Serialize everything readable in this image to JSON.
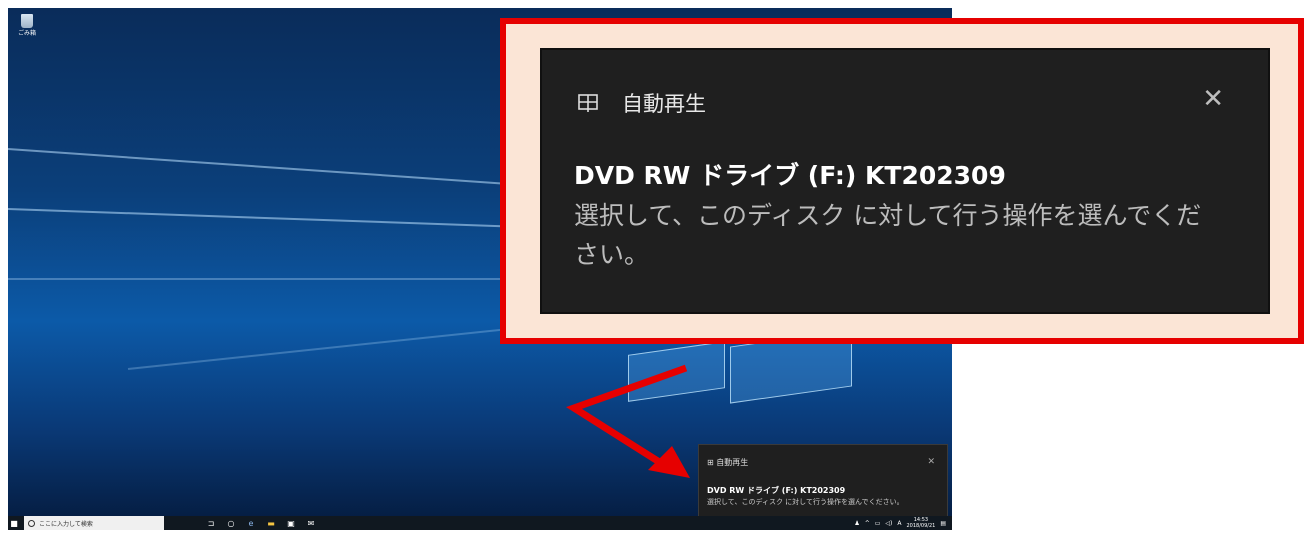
{
  "desktop": {
    "recycle_bin_label": "ごみ箱"
  },
  "taskbar": {
    "search_placeholder": "ここに入力して検索",
    "clock_time": "14:53",
    "clock_date": "2018/09/21",
    "ime_indicator": "A",
    "icons": [
      "windows-icon",
      "cortana-icon",
      "task-view-icon",
      "edge-icon",
      "file-explorer-icon",
      "store-icon",
      "mail-icon"
    ]
  },
  "toast": {
    "header": "自動再生",
    "device": "DVD RW ドライブ (F:) KT202309",
    "message": "選択して、このディスク に対して行う操作を選んでください。"
  },
  "callout": {
    "border_color": "#e60000",
    "fill_color": "#fbe5d6"
  }
}
